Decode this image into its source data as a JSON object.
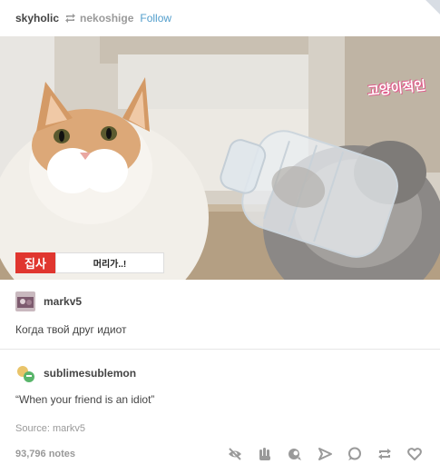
{
  "header": {
    "user": "skyholic",
    "reblog_icon": "reblog-icon",
    "source_user": "nekoshige",
    "follow_label": "Follow"
  },
  "photo": {
    "caption_tag": "집사",
    "caption_text": "머리가..!",
    "watermark": "고양이적인"
  },
  "replies": [
    {
      "name": "markv5",
      "text": "Когда твой друг идиот"
    },
    {
      "name": "sublimesublemon",
      "text": "“When your friend is an idiot”"
    }
  ],
  "footer": {
    "source": "Source: markv5",
    "notes": "93,796 notes",
    "action_icons": [
      "eye-hide-icon",
      "hands-icon",
      "eye-icon",
      "share-icon",
      "reply-icon",
      "reblog-icon",
      "heart-icon"
    ]
  },
  "colors": {
    "accent_blue": "#529ecc",
    "caption_red": "#e0362f",
    "muted_text": "#999999"
  }
}
